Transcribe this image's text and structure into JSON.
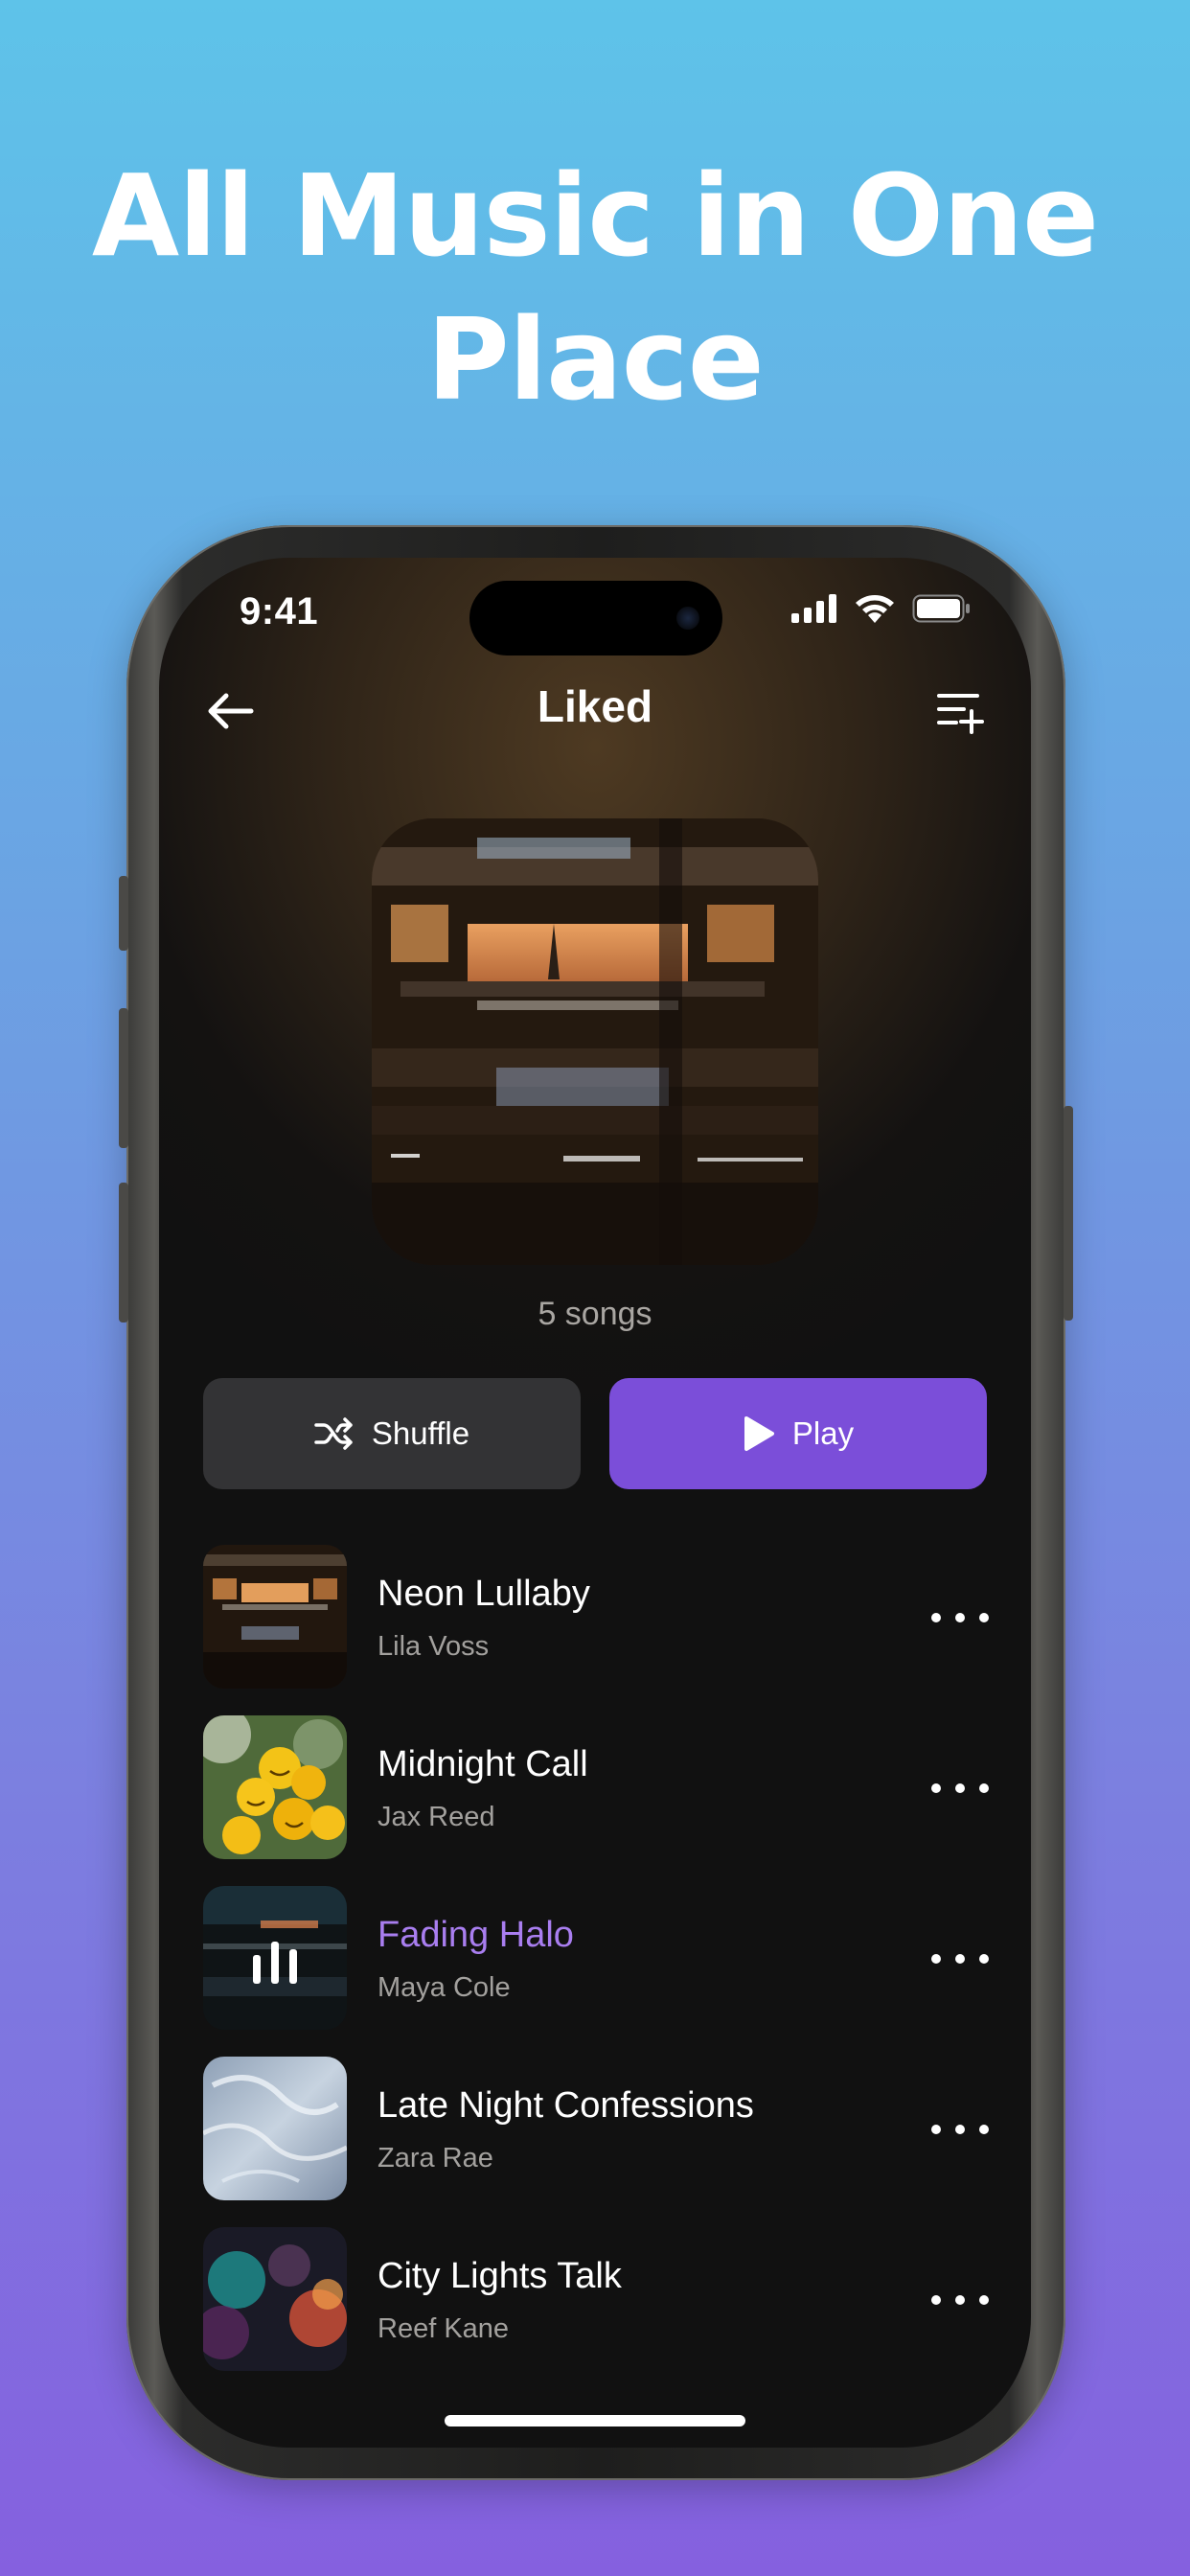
{
  "headline": {
    "line1": "All Music in One",
    "line2": "Place"
  },
  "status_bar": {
    "time": "9:41",
    "icons": [
      "cellular-signal-icon",
      "wifi-icon",
      "battery-icon"
    ]
  },
  "nav": {
    "title": "Liked",
    "back_icon": "arrow-left-icon",
    "queue_icon": "playlist-add-icon"
  },
  "playlist": {
    "song_count": "5 songs"
  },
  "actions": {
    "shuffle_label": "Shuffle",
    "play_label": "Play"
  },
  "songs": [
    {
      "title": "Neon Lullaby",
      "artist": "Lila Voss",
      "playing": false
    },
    {
      "title": "Midnight Call",
      "artist": "Jax Reed",
      "playing": false
    },
    {
      "title": "Fading Halo",
      "artist": "Maya Cole",
      "playing": true
    },
    {
      "title": "Late Night Confessions",
      "artist": "Zara Rae",
      "playing": false
    },
    {
      "title": "City Lights Talk",
      "artist": "Reef Kane",
      "playing": false
    }
  ],
  "colors": {
    "accent": "#7b4ed9",
    "playing_text": "#a97ef0",
    "screen_bg": "#111111",
    "shuffle_bg": "#333335"
  }
}
